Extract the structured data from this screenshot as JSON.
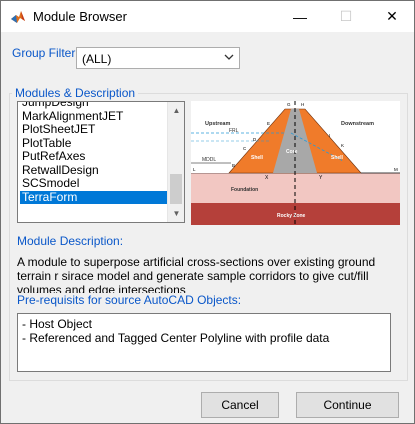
{
  "window": {
    "title": "Module Browser",
    "icon": "matlab-icon",
    "min_glyph": "—",
    "max_glyph": "☐",
    "close_glyph": "✕"
  },
  "group_filter": {
    "label": "Group Filter",
    "selected": "(ALL)"
  },
  "modules": {
    "legend": "Modules & Description",
    "items": [
      {
        "label": "JumpDesign",
        "selected": false,
        "partial": true
      },
      {
        "label": "MarkAlignmentJET",
        "selected": false
      },
      {
        "label": "PlotSheetJET",
        "selected": false
      },
      {
        "label": "PlotTable",
        "selected": false
      },
      {
        "label": "PutRefAxes",
        "selected": false
      },
      {
        "label": "RetwallDesign",
        "selected": false
      },
      {
        "label": "SCSmodel",
        "selected": false
      },
      {
        "label": "TerraForm",
        "selected": true
      }
    ]
  },
  "diagram": {
    "labels": {
      "upstream": "Upstream",
      "downstream": "Downstream",
      "frl": "FRL",
      "mddl": "MDDL",
      "shell_left": "Shell",
      "shell_right": "Shell",
      "core": "Core",
      "foundation": "Foundation",
      "rocky_zone": "Rocky Zone",
      "x": "X",
      "y": "Y",
      "l": "L",
      "m": "M",
      "b": "B",
      "c": "C",
      "d": "D",
      "e": "E",
      "g": "G",
      "h": "H",
      "k": "K",
      "i": "I"
    },
    "colors": {
      "shell": "#f07b2a",
      "core": "#a8a8a8",
      "foundation": "#f2c7c2",
      "rocky": "#b5403a",
      "water": "#8fd3e8"
    }
  },
  "description": {
    "label": "Module Description:",
    "text": "A module to superpose artificial cross-sections over existing ground terrain r sirace model and generate sample corridors to give cut/fill volumes and edge intersections"
  },
  "prerequisites": {
    "label": "Pre-requisits for source AutoCAD Objects:",
    "lines": [
      "- Host Object",
      "- Referenced and Tagged Center Polyline with profile data"
    ]
  },
  "buttons": {
    "cancel": "Cancel",
    "continue": "Continue"
  }
}
